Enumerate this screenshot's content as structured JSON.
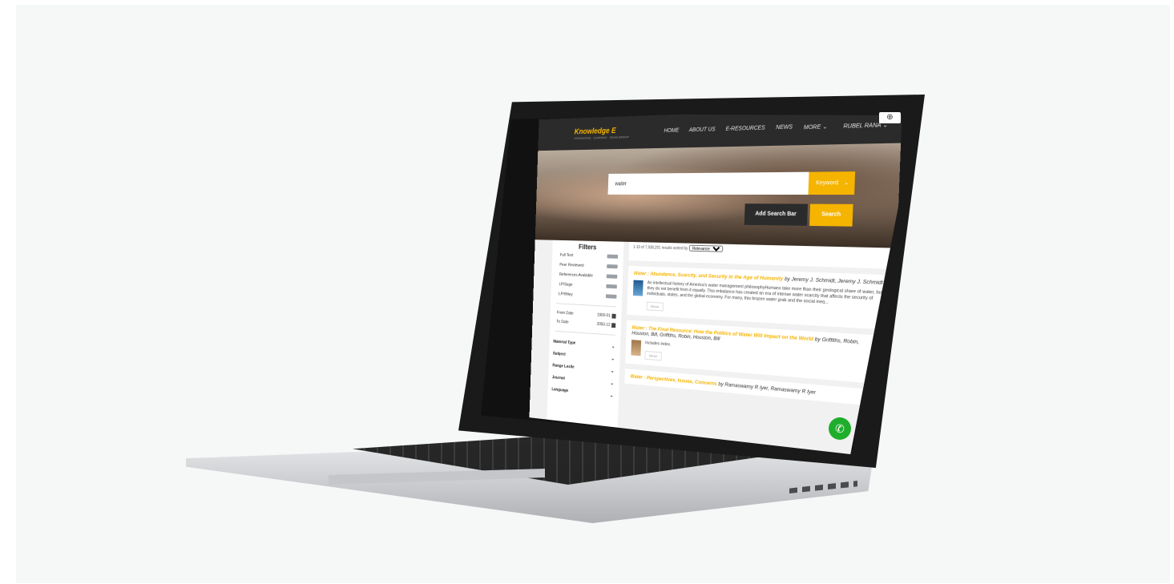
{
  "nav": {
    "logo": "Knowledge E",
    "logo_tagline": "KNOWLEDGE · LEARNING · SCHOLARSHIP",
    "items": [
      "HOME",
      "ABOUT US",
      "E-RESOURCES",
      "NEWS",
      "MORE ⌄"
    ],
    "user": "RUBEL RANA ⌄"
  },
  "search": {
    "query": "water",
    "type_button": "Keyword",
    "add_bar": "Add Search Bar",
    "submit": "Search"
  },
  "filters": {
    "title": "Filters",
    "toggles": [
      "Full Text",
      "Peer Reviewed",
      "References Available",
      "LP/Sage",
      "LP/Wiley"
    ],
    "from_label": "From Date",
    "from_value": "1900-01",
    "to_label": "To Date",
    "to_value": "2050-12",
    "sections": [
      "Material Type",
      "Subject",
      "Range Lexile",
      "Journal",
      "Language"
    ]
  },
  "results": {
    "count_text": "1-10 of 7,938,291 results sorted by",
    "sort_value": "Relevance",
    "items": [
      {
        "title": "Water : Abundance, Scarcity, and Security in the Age of Humanity",
        "authors": " by Jeremy J. Schmidt, Jeremy J. Schmidt",
        "desc": "An intellectual history of America's water management philosophyHumans take more than their geological share of water, but they do not benefit from it equally. This imbalance has created an era of intense water scarcity that affects the security of individuals, states, and the global economy. For many, this brazen water grab and the social ineq...",
        "format": "EBook"
      },
      {
        "title": "Water : The Final Resource: How the Politics of Water Will Impact on the World",
        "authors": " by Griffiths, Robin, Houston, Bill, Griffiths, Robin, Houston, Bill",
        "desc": "Includes index.",
        "format": "EBook"
      },
      {
        "title": "Water : Perspectives, Issues, Concerns",
        "authors": " by Ramaswamy R Iyer, Ramaswamy R Iyer"
      }
    ]
  },
  "colors": {
    "accent": "#f5b400",
    "nav_bg": "#2b2b2b",
    "whatsapp": "#1fae2c"
  },
  "icons": {
    "whatsapp": "whatsapp-icon",
    "chat": "chat-icon",
    "accessibility": "accessibility-icon"
  }
}
